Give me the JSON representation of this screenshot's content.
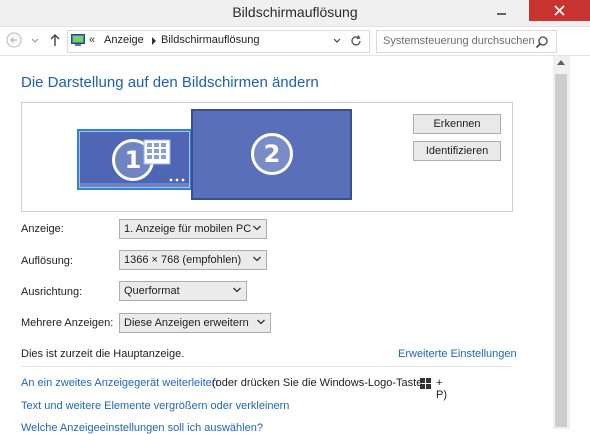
{
  "window": {
    "title": "Bildschirmauflösung"
  },
  "navigation": {
    "breadcrumb_overflow": "«",
    "breadcrumbs": [
      "Anzeige",
      "Bildschirmauflösung"
    ],
    "search_placeholder": "Systemsteuerung durchsuchen"
  },
  "heading": "Die Darstellung auf den Bildschirmen ändern",
  "monitors": [
    {
      "number": "1",
      "selected": true
    },
    {
      "number": "2",
      "selected": false
    }
  ],
  "buttons": {
    "detect": "Erkennen",
    "identify": "Identifizieren"
  },
  "settings": [
    {
      "label": "Anzeige:",
      "value": "1. Anzeige für mobilen PC"
    },
    {
      "label": "Auflösung:",
      "value": "1366 × 768 (empfohlen)"
    },
    {
      "label": "Ausrichtung:",
      "value": "Querformat"
    },
    {
      "label": "Mehrere Anzeigen:",
      "value": "Diese Anzeigen erweitern"
    }
  ],
  "main_display_text": "Dies ist zurzeit die Hauptanzeige.",
  "advanced_link": "Erweiterte Einstellungen",
  "links": {
    "connect_second": "An ein zweites Anzeigegerät weiterleiten",
    "connect_second_hint": "(oder drücken Sie die Windows-Logo-Taste",
    "connect_second_suffix": "+ P)",
    "enlarge_text": "Text und weitere Elemente vergrößern oder verkleinern",
    "which_settings": "Welche Anzeigeeinstellungen soll ich auswählen?"
  },
  "colors": {
    "heading": "#1e5fb0",
    "link": "#1e66c0",
    "close_button": "#c7342f",
    "monitor_selected": "#4e66b3",
    "monitor_other": "#5a6fb9"
  }
}
